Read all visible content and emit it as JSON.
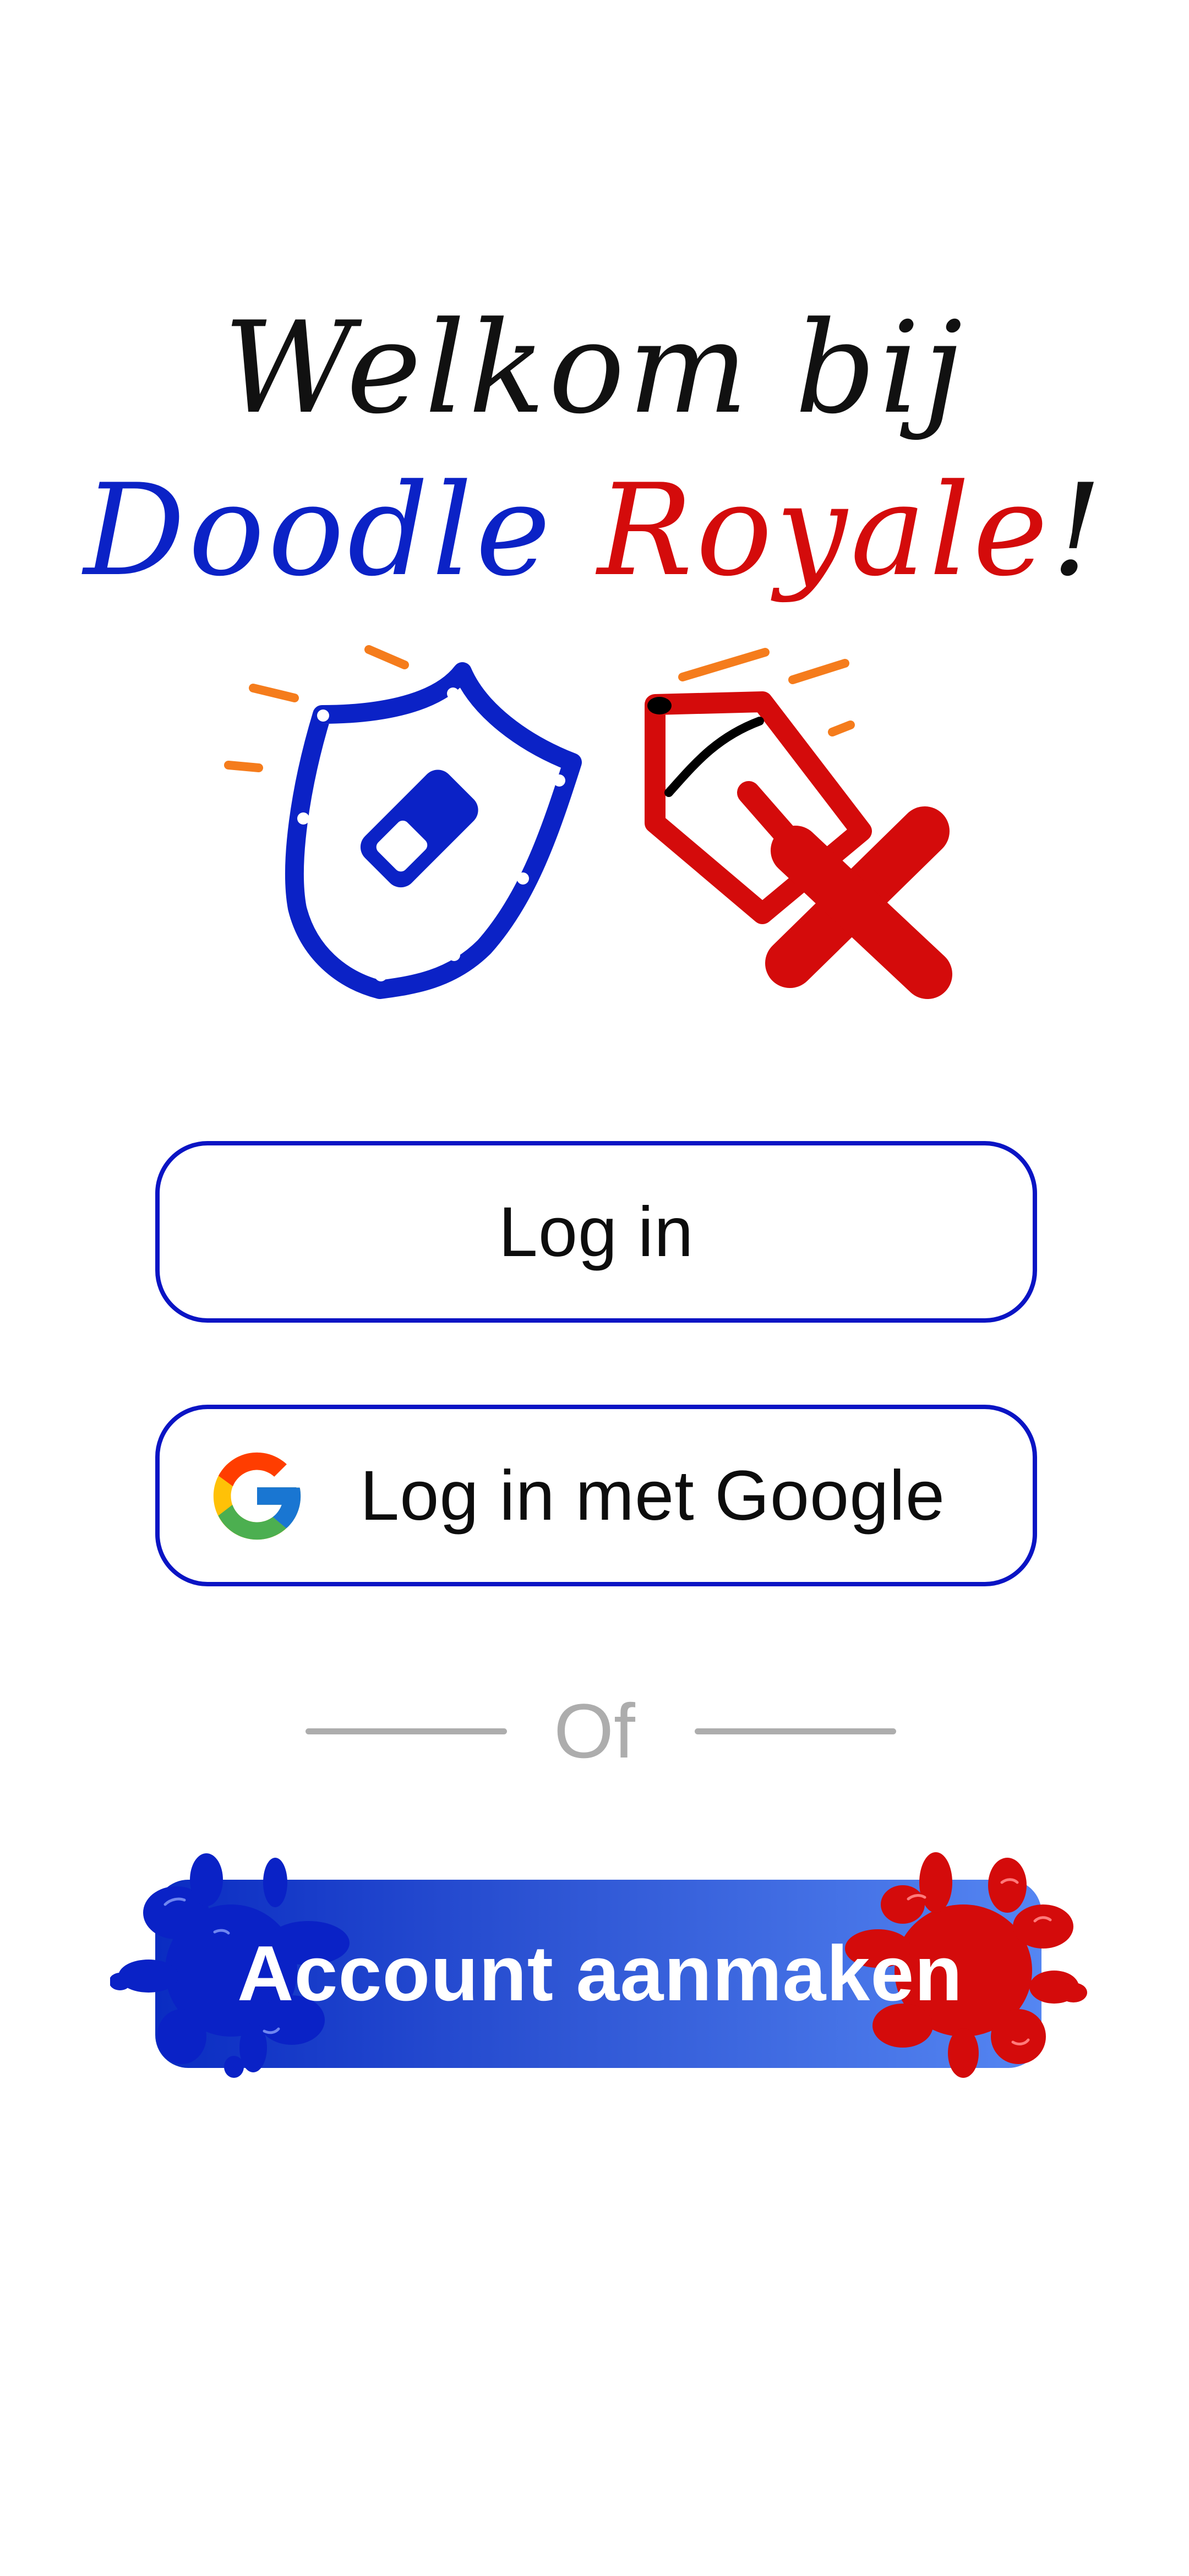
{
  "welcome": {
    "line1": "Welkom bij",
    "brand_part1": "Doodle",
    "brand_part2": "Royale",
    "punctuation": "!"
  },
  "hero": {
    "left_icon": "shield-eraser-icon",
    "right_icon": "pen-sword-icon"
  },
  "buttons": {
    "login_label": "Log in",
    "google_label": "Log in met Google",
    "google_icon": "google-icon",
    "create_label": "Account aanmaken"
  },
  "divider": {
    "text": "Of"
  },
  "colors": {
    "brand_blue": "#0b22c6",
    "brand_red": "#d40b0b",
    "accent_orange": "#f57c1c",
    "outline_blue": "#0a14c4",
    "divider_gray": "#adadad"
  }
}
